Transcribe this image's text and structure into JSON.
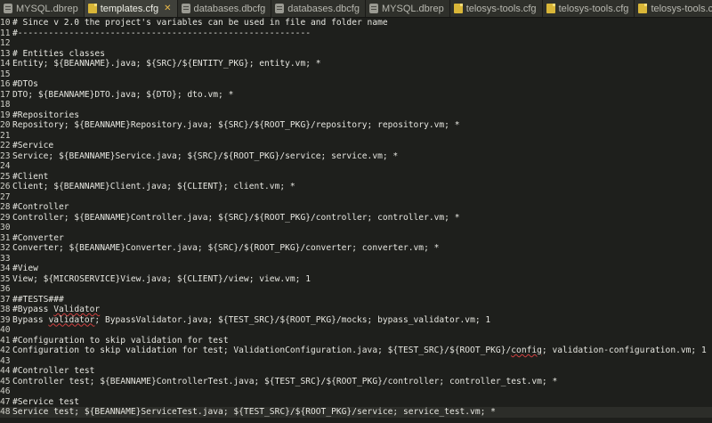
{
  "tabs": [
    {
      "label": "MYSQL.dbrep",
      "icon": "database-file-icon",
      "active": false
    },
    {
      "label": "templates.cfg",
      "icon": "config-file-icon",
      "active": true,
      "close": "✕"
    },
    {
      "label": "databases.dbcfg",
      "icon": "database-file-icon",
      "active": false
    },
    {
      "label": "databases.dbcfg",
      "icon": "database-file-icon",
      "active": false
    },
    {
      "label": "MYSQL.dbrep",
      "icon": "database-file-icon",
      "active": false
    },
    {
      "label": "telosys-tools.cfg",
      "icon": "config-file-icon",
      "active": false
    },
    {
      "label": "telosys-tools.cfg",
      "icon": "config-file-icon",
      "active": false
    },
    {
      "label": "telosys-tools.cfg",
      "icon": "config-file-icon",
      "active": false
    }
  ],
  "lines": [
    {
      "n": "10",
      "text": "# Since v 2.0 the project's variables can be used in file and folder name"
    },
    {
      "n": "11",
      "text": "#---------------------------------------------------------"
    },
    {
      "n": "12",
      "text": ""
    },
    {
      "n": "13",
      "text": "# Entities classes"
    },
    {
      "n": "14",
      "text": "Entity; ${BEANNAME}.java; ${SRC}/${ENTITY_PKG}; entity.vm; *"
    },
    {
      "n": "15",
      "text": ""
    },
    {
      "n": "16",
      "text": "#DTOs"
    },
    {
      "n": "17",
      "text": "DTO; ${BEANNAME}DTO.java; ${DTO}; dto.vm; *"
    },
    {
      "n": "18",
      "text": ""
    },
    {
      "n": "19",
      "text": "#Repositories"
    },
    {
      "n": "20",
      "text": "Repository; ${BEANNAME}Repository.java; ${SRC}/${ROOT_PKG}/repository; repository.vm; *"
    },
    {
      "n": "21",
      "text": ""
    },
    {
      "n": "22",
      "text": "#Service"
    },
    {
      "n": "23",
      "text": "Service; ${BEANNAME}Service.java; ${SRC}/${ROOT_PKG}/service; service.vm; *"
    },
    {
      "n": "24",
      "text": ""
    },
    {
      "n": "25",
      "text": "#Client"
    },
    {
      "n": "26",
      "text": "Client; ${BEANNAME}Client.java; ${CLIENT}; client.vm; *"
    },
    {
      "n": "27",
      "text": ""
    },
    {
      "n": "28",
      "text": "#Controller"
    },
    {
      "n": "29",
      "text": "Controller; ${BEANNAME}Controller.java; ${SRC}/${ROOT_PKG}/controller; controller.vm; *"
    },
    {
      "n": "30",
      "text": ""
    },
    {
      "n": "31",
      "text": "#Converter"
    },
    {
      "n": "32",
      "text": "Converter; ${BEANNAME}Converter.java; ${SRC}/${ROOT_PKG}/converter; converter.vm; *"
    },
    {
      "n": "33",
      "text": ""
    },
    {
      "n": "34",
      "text": "#View"
    },
    {
      "n": "35",
      "text": "View; ${MICROSERVICE}View.java; ${CLIENT}/view; view.vm; 1"
    },
    {
      "n": "36",
      "text": ""
    },
    {
      "n": "37",
      "text": "##TESTS###"
    },
    {
      "n": "38",
      "text": "#Bypass Validator"
    },
    {
      "n": "39",
      "text": "Bypass validator; BypassValidator.java; ${TEST_SRC}/${ROOT_PKG}/mocks; bypass_validator.vm; 1"
    },
    {
      "n": "40",
      "text": ""
    },
    {
      "n": "41",
      "text": "#Configuration to skip validation for test"
    },
    {
      "n": "42",
      "text": "Configuration to skip validation for test; ValidationConfiguration.java; ${TEST_SRC}/${ROOT_PKG}/config; validation-configuration.vm; 1"
    },
    {
      "n": "43",
      "text": ""
    },
    {
      "n": "44",
      "text": "#Controller test"
    },
    {
      "n": "45",
      "text": "Controller test; ${BEANNAME}ControllerTest.java; ${TEST_SRC}/${ROOT_PKG}/controller; controller_test.vm; *"
    },
    {
      "n": "46",
      "text": ""
    },
    {
      "n": "47",
      "text": "#Service test"
    },
    {
      "n": "48",
      "text": "Service test; ${BEANNAME}ServiceTest.java; ${TEST_SRC}/${ROOT_PKG}/service; service_test.vm; *"
    }
  ],
  "colors": {
    "background": "#1e1f1c",
    "active_tab": "#3f403a",
    "close": "#e8b84a"
  }
}
